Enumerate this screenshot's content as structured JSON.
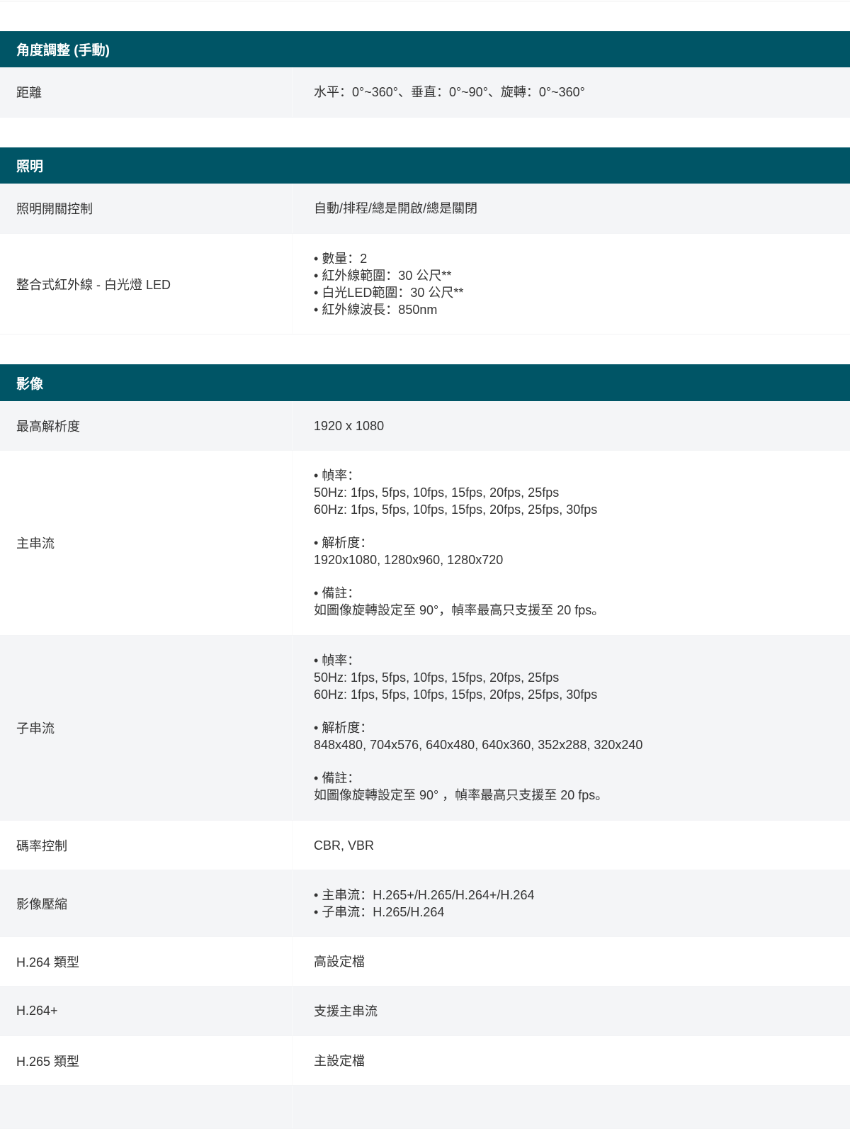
{
  "sections": [
    {
      "title": "角度調整 (手動)",
      "rows": [
        {
          "label": "距離",
          "value": "水平：0°~360°、垂直：0°~90°、旋轉：0°~360°"
        }
      ]
    },
    {
      "title": "照明",
      "rows": [
        {
          "label": "照明開關控制",
          "value": "自動/排程/總是開啟/總是關閉"
        },
        {
          "label": "整合式紅外線 - 白光燈 LED",
          "bullets": [
            "數量：2",
            "紅外線範圍：30 公尺**",
            "白光LED範圍：30 公尺**",
            "紅外線波長：850nm"
          ]
        }
      ]
    },
    {
      "title": "影像",
      "rows": [
        {
          "label": "最高解析度",
          "value": "1920 x 1080"
        },
        {
          "label": "主串流",
          "frame_rate_title": "幀率：",
          "frame_rate_50": "50Hz: 1fps, 5fps, 10fps, 15fps, 20fps, 25fps",
          "frame_rate_60": "60Hz: 1fps, 5fps, 10fps, 15fps, 20fps, 25fps, 30fps",
          "resolution_title": "解析度：",
          "resolutions": "1920x1080, 1280x960, 1280x720",
          "note_title": "備註：",
          "note": "如圖像旋轉設定至 90°，幀率最高只支援至 20 fps。"
        },
        {
          "label": "子串流",
          "frame_rate_title": "幀率：",
          "frame_rate_50": "50Hz: 1fps, 5fps, 10fps, 15fps, 20fps, 25fps",
          "frame_rate_60": "60Hz: 1fps, 5fps, 10fps, 15fps, 20fps, 25fps, 30fps",
          "resolution_title": "解析度：",
          "resolutions": "848x480, 704x576, 640x480, 640x360, 352x288, 320x240",
          "note_title": "備註：",
          "note": "如圖像旋轉設定至 90° ，幀率最高只支援至 20 fps。"
        },
        {
          "label": "碼率控制",
          "value": "CBR, VBR"
        },
        {
          "label": "影像壓縮",
          "bullets": [
            "主串流：H.265+/H.265/H.264+/H.264",
            "子串流：H.265/H.264"
          ]
        },
        {
          "label": "H.264 類型",
          "value": "高設定檔"
        },
        {
          "label": "H.264+",
          "value": "支援主串流"
        },
        {
          "label": "H.265 類型",
          "value": "主設定檔"
        }
      ]
    }
  ]
}
